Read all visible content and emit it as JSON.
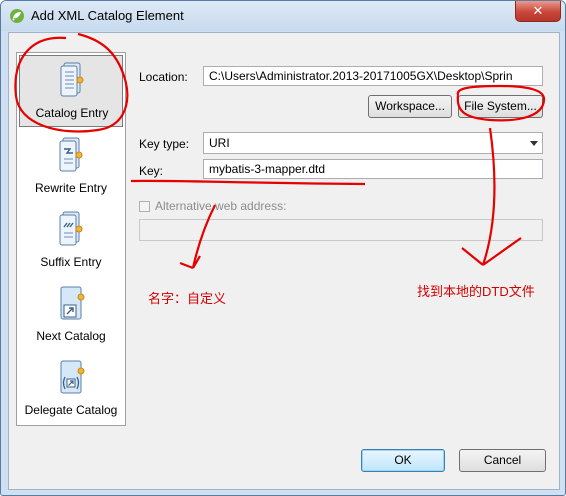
{
  "window": {
    "title": "Add XML Catalog Element",
    "close_glyph": "✕"
  },
  "catalog_list": {
    "items": [
      {
        "label": "Catalog Entry",
        "icon": "catalog-entry-icon",
        "selected": true
      },
      {
        "label": "Rewrite Entry",
        "icon": "rewrite-entry-icon",
        "selected": false
      },
      {
        "label": "Suffix Entry",
        "icon": "suffix-entry-icon",
        "selected": false
      },
      {
        "label": "Next Catalog",
        "icon": "next-catalog-icon",
        "selected": false
      },
      {
        "label": "Delegate Catalog",
        "icon": "delegate-catalog-icon",
        "selected": false
      }
    ]
  },
  "form": {
    "location_label": "Location:",
    "location_value": "C:\\Users\\Administrator.2013-20171005GX\\Desktop\\Sprin",
    "workspace_button": "Workspace...",
    "filesystem_button": "File System...",
    "keytype_label": "Key type:",
    "keytype_value": "URI",
    "key_label": "Key:",
    "key_value": "mybatis-3-mapper.dtd",
    "alt_label": "Alternative web address:",
    "alt_checked": false,
    "alt_value": ""
  },
  "annotations": {
    "key_note": "名字：自定义",
    "file_note": "找到本地的DTD文件",
    "color": "#d40000"
  },
  "footer": {
    "ok_button": "OK",
    "cancel_button": "Cancel"
  },
  "colors": {
    "titlebar": "#c8daee",
    "client": "#f0f0f0",
    "close": "#c9463a",
    "default_button": "#3c7fb1"
  }
}
